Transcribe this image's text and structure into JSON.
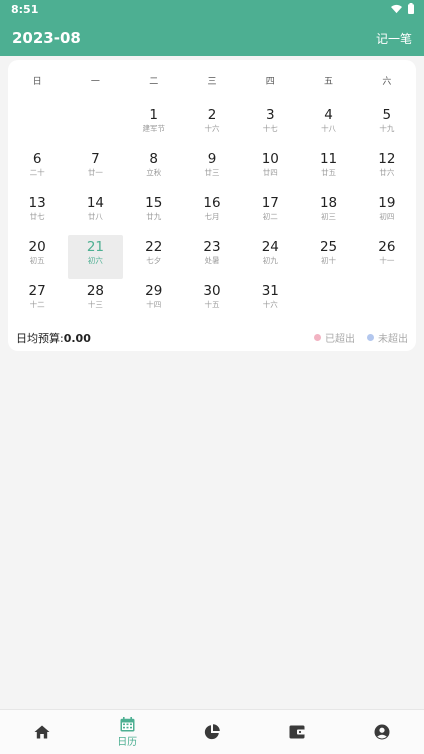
{
  "status": {
    "time": "8:51"
  },
  "header": {
    "title": "2023-08",
    "record_label": "记一笔"
  },
  "calendar": {
    "weekdays": [
      "日",
      "一",
      "二",
      "三",
      "四",
      "五",
      "六"
    ],
    "days": [
      {
        "num": "",
        "sub": ""
      },
      {
        "num": "",
        "sub": ""
      },
      {
        "num": "1",
        "sub": "建军节"
      },
      {
        "num": "2",
        "sub": "十六"
      },
      {
        "num": "3",
        "sub": "十七"
      },
      {
        "num": "4",
        "sub": "十八"
      },
      {
        "num": "5",
        "sub": "十九"
      },
      {
        "num": "6",
        "sub": "二十"
      },
      {
        "num": "7",
        "sub": "廿一"
      },
      {
        "num": "8",
        "sub": "立秋"
      },
      {
        "num": "9",
        "sub": "廿三"
      },
      {
        "num": "10",
        "sub": "廿四"
      },
      {
        "num": "11",
        "sub": "廿五"
      },
      {
        "num": "12",
        "sub": "廿六"
      },
      {
        "num": "13",
        "sub": "廿七"
      },
      {
        "num": "14",
        "sub": "廿八"
      },
      {
        "num": "15",
        "sub": "廿九"
      },
      {
        "num": "16",
        "sub": "七月"
      },
      {
        "num": "17",
        "sub": "初二"
      },
      {
        "num": "18",
        "sub": "初三"
      },
      {
        "num": "19",
        "sub": "初四"
      },
      {
        "num": "20",
        "sub": "初五"
      },
      {
        "num": "21",
        "sub": "初六"
      },
      {
        "num": "22",
        "sub": "七夕"
      },
      {
        "num": "23",
        "sub": "处暑"
      },
      {
        "num": "24",
        "sub": "初九"
      },
      {
        "num": "25",
        "sub": "初十"
      },
      {
        "num": "26",
        "sub": "十一"
      },
      {
        "num": "27",
        "sub": "十二"
      },
      {
        "num": "28",
        "sub": "十三"
      },
      {
        "num": "29",
        "sub": "十四"
      },
      {
        "num": "30",
        "sub": "十五"
      },
      {
        "num": "31",
        "sub": "十六"
      }
    ],
    "selected_day": "21"
  },
  "budget": {
    "label": "日均预算:",
    "value": "0.00"
  },
  "legend": {
    "exceeded": {
      "label": "已超出",
      "color": "#f2b3c2"
    },
    "not_exceeded": {
      "label": "未超出",
      "color": "#b3c7ee"
    }
  },
  "nav": {
    "items": [
      {
        "icon": "home-icon",
        "label": ""
      },
      {
        "icon": "calendar-icon",
        "label": "日历"
      },
      {
        "icon": "pie-chart-icon",
        "label": ""
      },
      {
        "icon": "wallet-icon",
        "label": ""
      },
      {
        "icon": "account-icon",
        "label": ""
      }
    ]
  },
  "colors": {
    "accent": "#4daf92"
  }
}
